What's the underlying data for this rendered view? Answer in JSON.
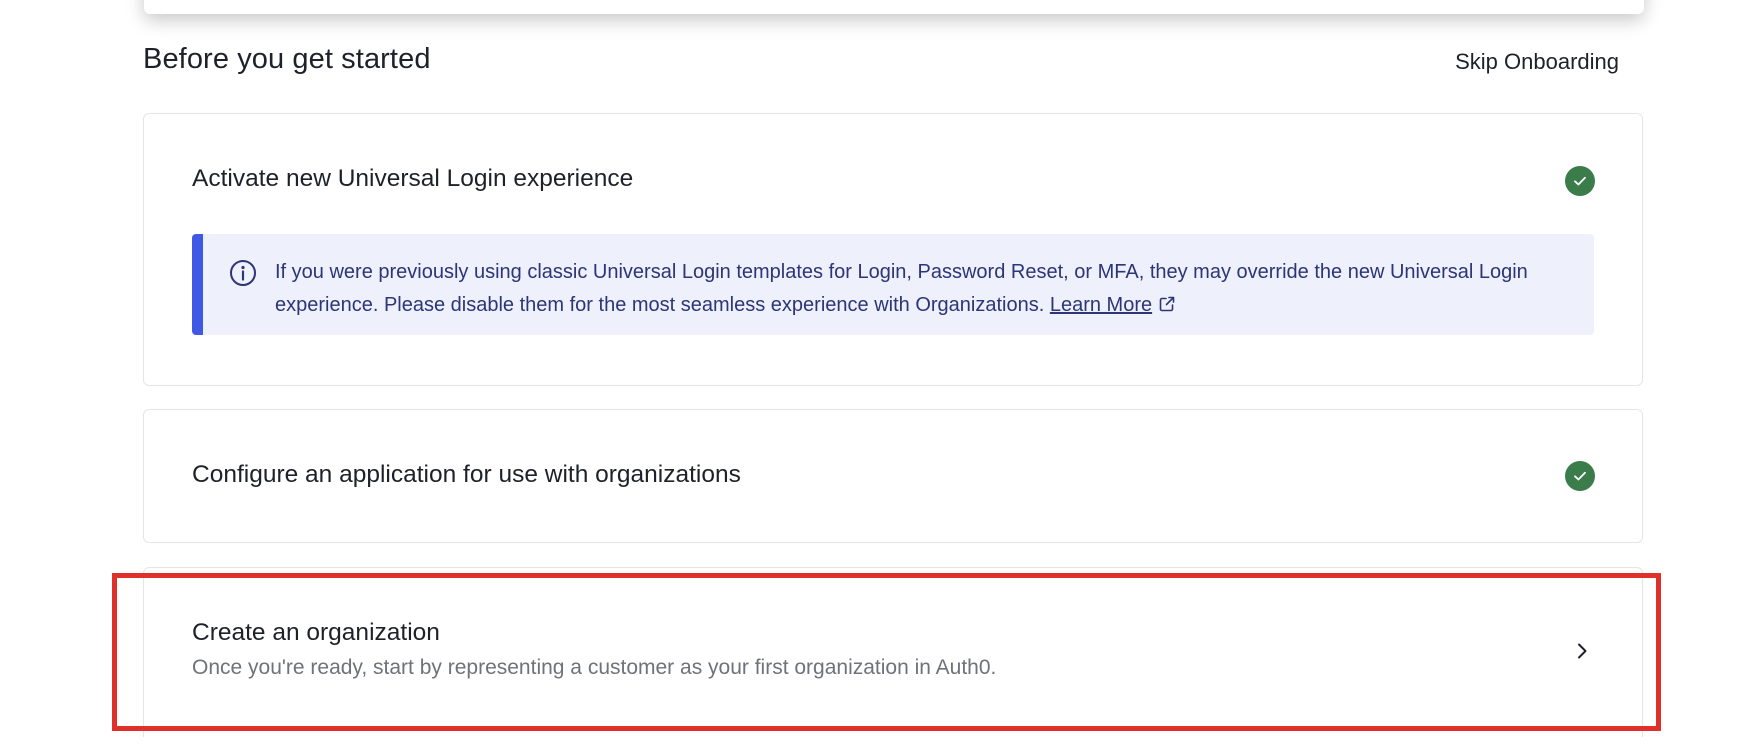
{
  "header": {
    "title": "Before you get started",
    "skip_label": "Skip Onboarding"
  },
  "steps": [
    {
      "title": "Activate new Universal Login experience",
      "status": "complete",
      "status_icon": "check-circle-icon",
      "notice": {
        "icon": "info-icon",
        "text": "If you were previously using classic Universal Login templates for Login, Password Reset, or MFA, they may override the new Universal Login experience. Please disable them for the most seamless experience with Organizations.",
        "link_label": "Learn More",
        "link_icon": "external-link-icon"
      }
    },
    {
      "title": "Configure an application for use with organizations",
      "status": "complete",
      "status_icon": "check-circle-icon"
    },
    {
      "title": "Create an organization",
      "description": "Once you're ready, start by representing a customer as your first organization in Auth0.",
      "status": "pending",
      "action_icon": "chevron-right-icon"
    }
  ],
  "colors": {
    "success": "#3a7d4a",
    "info_accent": "#3f59e4",
    "info_background": "#eef0fb",
    "info_text": "#2c3577",
    "highlight": "#e0302a"
  }
}
